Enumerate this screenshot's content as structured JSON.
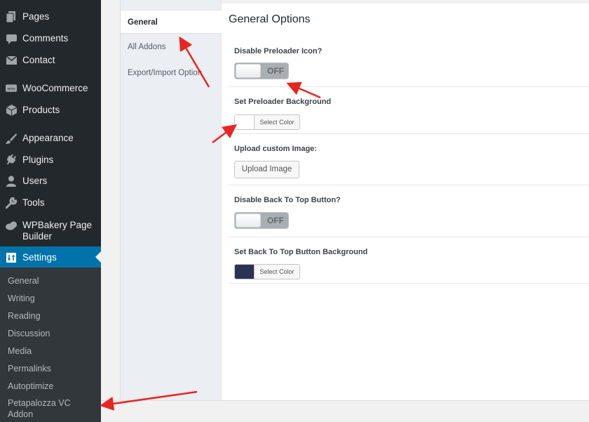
{
  "sidebar": {
    "items": [
      {
        "label": "Pages",
        "icon": "pages-icon"
      },
      {
        "label": "Comments",
        "icon": "comments-icon"
      },
      {
        "label": "Contact",
        "icon": "mail-icon"
      },
      {
        "label": "WooCommerce",
        "icon": "woocommerce-icon"
      },
      {
        "label": "Products",
        "icon": "products-icon"
      },
      {
        "label": "Appearance",
        "icon": "appearance-icon"
      },
      {
        "label": "Plugins",
        "icon": "plugins-icon"
      },
      {
        "label": "Users",
        "icon": "users-icon"
      },
      {
        "label": "Tools",
        "icon": "tools-icon"
      },
      {
        "label": "WPBakery Page Builder",
        "icon": "wpbakery-icon"
      },
      {
        "label": "Settings",
        "icon": "settings-icon"
      }
    ],
    "submenu": [
      "General",
      "Writing",
      "Reading",
      "Discussion",
      "Media",
      "Permalinks",
      "Autoptimize",
      "Petapalozza VC Addon"
    ],
    "accent_color": "#0073aa"
  },
  "tabs": [
    "General",
    "All Addons",
    "Export/Import Option"
  ],
  "panel": {
    "title": "General Options",
    "options": [
      {
        "label": "Disable Preloader Icon?",
        "toggle": "OFF"
      },
      {
        "label": "Set Preloader Background",
        "button": "Select Color",
        "color": "#ffffff"
      },
      {
        "label": "Upload custom Image:",
        "button": "Upload Image"
      },
      {
        "label": "Disable Back To Top Button?",
        "toggle": "OFF"
      },
      {
        "label": "Set Back To Top Button Background",
        "button": "Select Color",
        "color": "#2b3354"
      }
    ]
  },
  "annotation_color": "#e8251f"
}
